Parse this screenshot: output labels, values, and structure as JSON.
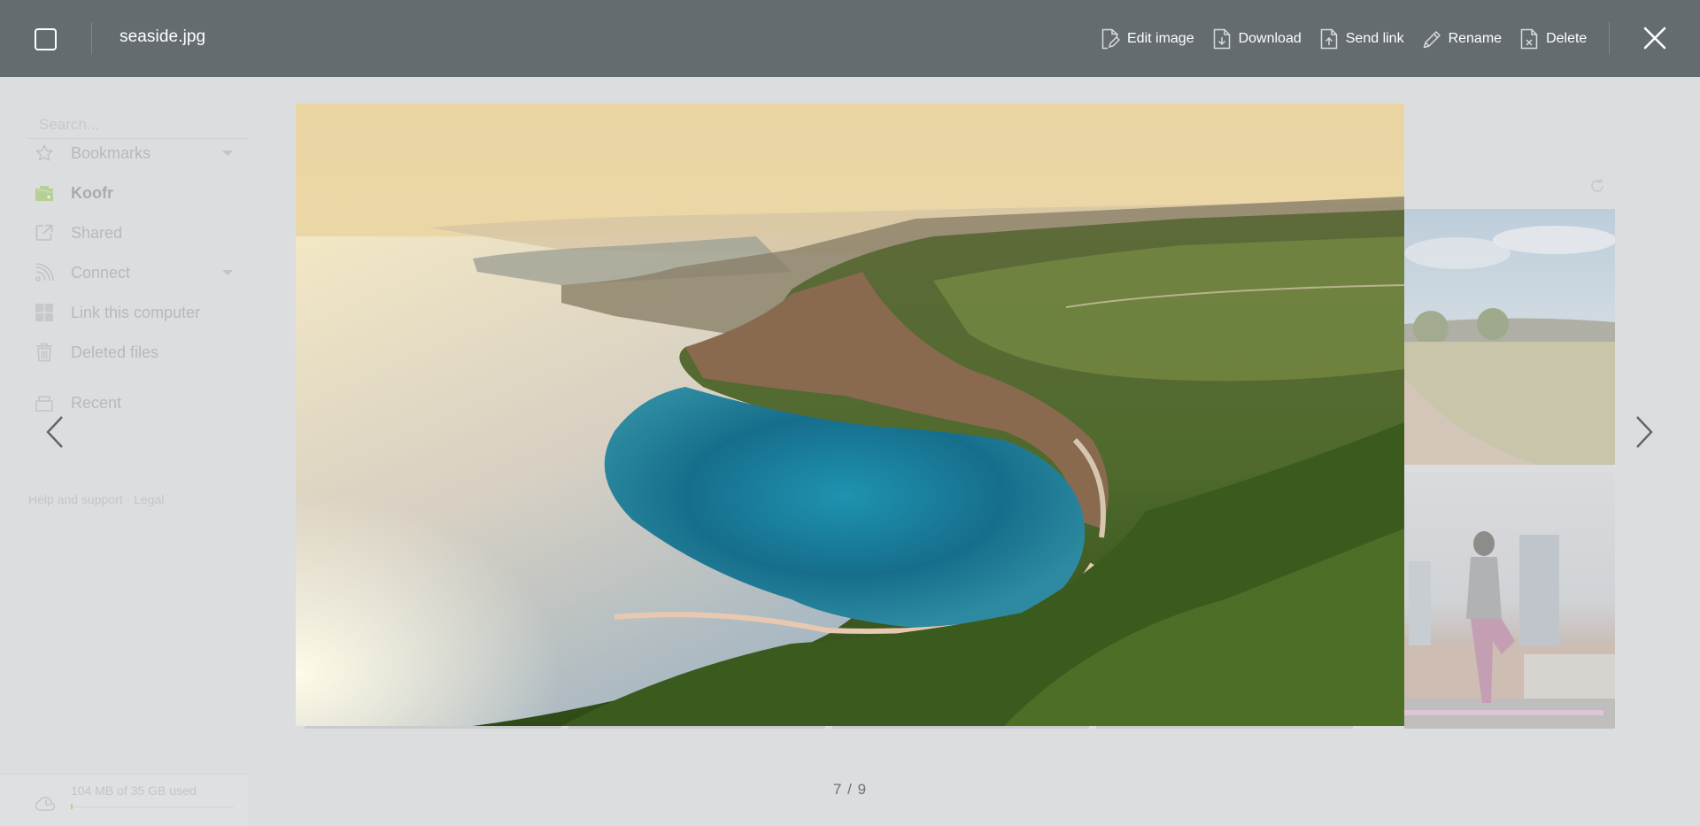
{
  "topbar": {
    "filename": "seaside.jpg",
    "actions": [
      {
        "label": "Edit image",
        "icon": "edit-file-icon"
      },
      {
        "label": "Download",
        "icon": "download-file-icon"
      },
      {
        "label": "Send link",
        "icon": "upload-file-icon"
      },
      {
        "label": "Rename",
        "icon": "pencil-icon"
      },
      {
        "label": "Delete",
        "icon": "delete-file-icon"
      }
    ],
    "close_icon": "close-icon"
  },
  "sidebar": {
    "search_placeholder": "Search...",
    "items": [
      {
        "label": "Bookmarks",
        "icon": "star-icon",
        "has_caret": true
      },
      {
        "label": "Koofr",
        "icon": "koofr-folder-icon",
        "active": true
      },
      {
        "label": "Shared",
        "icon": "share-icon"
      },
      {
        "label": "Connect",
        "icon": "rss-icon",
        "has_caret": true
      },
      {
        "label": "Link this computer",
        "icon": "windows-icon"
      },
      {
        "label": "Deleted files",
        "icon": "trash-icon"
      },
      {
        "label": "Recent",
        "icon": "recent-icon"
      }
    ],
    "footer": {
      "help": "Help and support",
      "separator": "·",
      "legal": "Legal"
    },
    "storage": {
      "text": "104 MB of 35 GB used",
      "used_fraction": 0.003,
      "accent": "#b5cf96"
    }
  },
  "viewer": {
    "current": 7,
    "total": 9,
    "counter_text": "7 / 9",
    "image_alt": "Aerial view of a seaside cliff and turquoise bay at sunset"
  },
  "colors": {
    "topbar_bg": "#656c70",
    "page_bg": "#dcdddf",
    "koofr_green": "#b5cf96"
  }
}
